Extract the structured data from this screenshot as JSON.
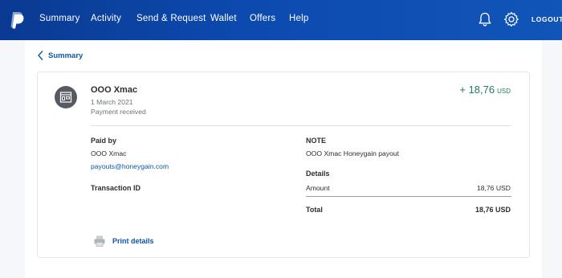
{
  "nav": {
    "items": [
      "Summary",
      "Activity",
      "Send & Request",
      "Wallet",
      "Offers",
      "Help"
    ],
    "logout": "LOGOUT"
  },
  "back_link": "Summary",
  "transaction": {
    "merchant": "OOO Xmac",
    "date": "1 March 2021",
    "status": "Payment received",
    "amount": "+ 18,76",
    "currency": "USD"
  },
  "paid_by": {
    "label": "Paid by",
    "name": "OOO Xmac",
    "email": "payouts@honeygain.com"
  },
  "transaction_id": {
    "label": "Transaction ID"
  },
  "note": {
    "label": "NOTE",
    "text": "OOO Xmac Honeygain payout"
  },
  "details": {
    "label": "Details",
    "amount_label": "Amount",
    "amount_value": "18,76 USD",
    "total_label": "Total",
    "total_value": "18,76 USD"
  },
  "print_label": "Print details",
  "colors": {
    "header_blue": "#0d4ab0",
    "link_blue": "#0a58a8",
    "positive_green": "#1f7a5e"
  }
}
